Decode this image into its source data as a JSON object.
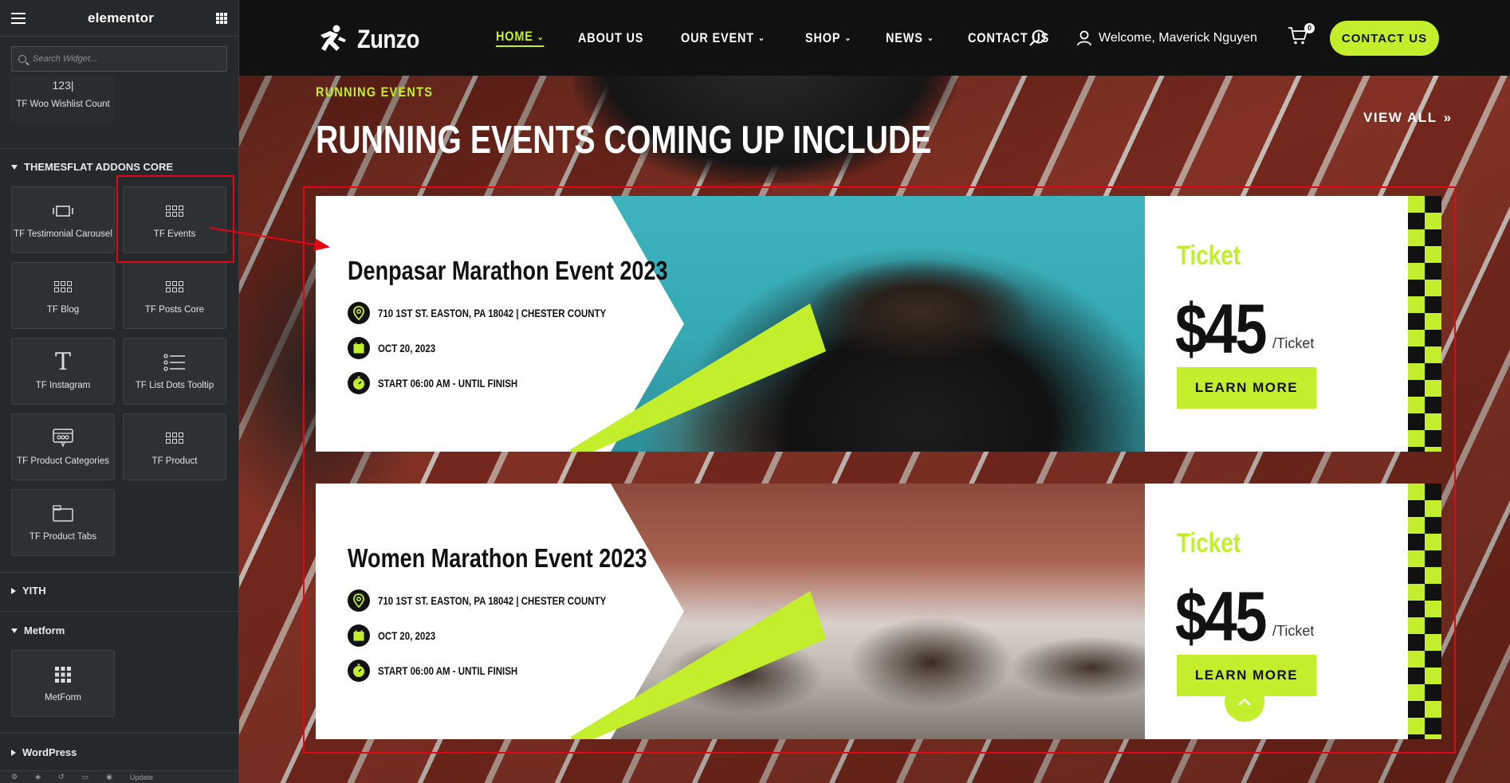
{
  "sidebar": {
    "brand": "elementor",
    "search_placeholder": "Search Widget...",
    "top_widget": {
      "icon_text": "123|",
      "label": "TF Woo Wishlist Count"
    },
    "sections": {
      "themesflat": "THEMESFLAT ADDONS CORE",
      "yith": "YITH",
      "metform": "Metform",
      "wordpress": "WordPress"
    },
    "widgets": [
      {
        "label": "TF Testimonial Carousel",
        "icon": "carousel-icon"
      },
      {
        "label": "TF Events",
        "icon": "grid-icon"
      },
      {
        "label": "TF Blog",
        "icon": "grid-icon"
      },
      {
        "label": "TF Posts Core",
        "icon": "grid-icon"
      },
      {
        "label": "TF Instagram",
        "icon": "text-t-icon"
      },
      {
        "label": "TF List Dots Tooltip",
        "icon": "list-icon"
      },
      {
        "label": "TF Product Categories",
        "icon": "categories-icon"
      },
      {
        "label": "TF Product",
        "icon": "grid-icon"
      },
      {
        "label": "TF Product Tabs",
        "icon": "tabs-icon"
      }
    ],
    "metform_widget": {
      "label": "MetForm",
      "icon": "dots-grid-icon"
    },
    "footer_update": "Update"
  },
  "site": {
    "logo": "Zunzo",
    "nav": [
      {
        "label": "HOME",
        "dropdown": true,
        "active": true
      },
      {
        "label": "ABOUT US",
        "dropdown": false,
        "active": false
      },
      {
        "label": "OUR EVENT",
        "dropdown": true,
        "active": false
      },
      {
        "label": "SHOP",
        "dropdown": true,
        "active": false
      },
      {
        "label": "NEWS",
        "dropdown": true,
        "active": false
      },
      {
        "label": "CONTACT US",
        "dropdown": false,
        "active": false
      }
    ],
    "welcome": "Welcome, Maverick Nguyen",
    "cart_count": "0",
    "contact_button": "CONTACT US",
    "accent": "#c3ee2b"
  },
  "section": {
    "kicker": "RUNNING EVENTS",
    "heading": "RUNNING EVENTS COMING UP INCLUDE",
    "view_all": "VIEW ALL"
  },
  "events": [
    {
      "title": "Denpasar Marathon Event 2023",
      "address": "710 1ST ST. EASTON, PA 18042 | CHESTER COUNTY",
      "date": "OCT 20, 2023",
      "time": "START 06:00 AM - UNTIL FINISH",
      "ticket_label": "Ticket",
      "price": "$45",
      "per": "/Ticket",
      "button": "LEARN MORE"
    },
    {
      "title": "Women Marathon Event 2023",
      "address": "710 1ST ST. EASTON, PA 18042 | CHESTER COUNTY",
      "date": "OCT 20, 2023",
      "time": "START 06:00 AM - UNTIL FINISH",
      "ticket_label": "Ticket",
      "price": "$45",
      "per": "/Ticket",
      "button": "LEARN MORE"
    }
  ]
}
